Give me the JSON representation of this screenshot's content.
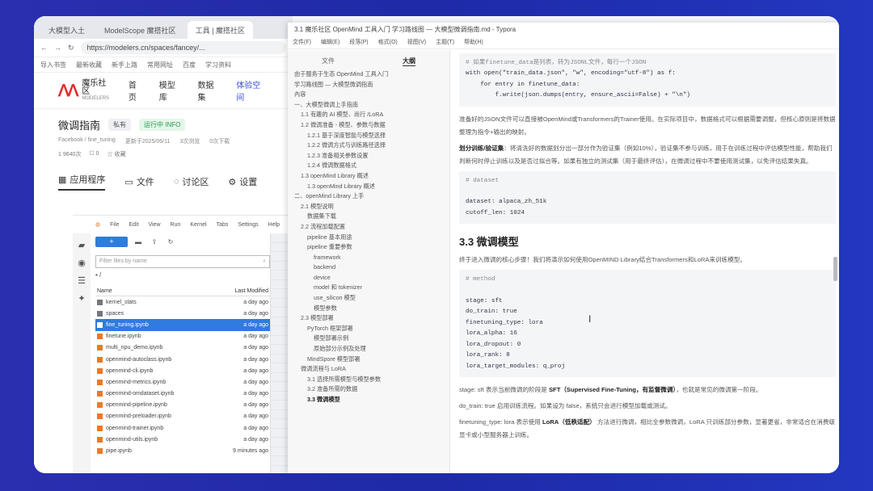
{
  "browser": {
    "tabs": [
      {
        "label": "大模型入土"
      },
      {
        "label": "ModelScope 魔搭社区"
      },
      {
        "label": "工具 | 魔搭社区"
      }
    ],
    "url": "https://modelers.cn/spaces/fancey/...",
    "bookmarks": [
      "导入书签",
      "最新收藏",
      "新手上路",
      "常用网址",
      "百度",
      "学习资料"
    ],
    "site": {
      "logo_text": "魔乐社区",
      "logo_sub": "MODELERS",
      "nav": [
        "首页",
        "模型库",
        "数据集",
        "体验空间"
      ],
      "active_nav": "体验空间"
    },
    "project": {
      "title": "微调指南",
      "badge": "私有",
      "status": "运行中 INFO",
      "meta": [
        "Facebook / fine_tuning",
        "更新于2025/06/11",
        "3次浏览",
        "0次下载"
      ],
      "meta2": [
        "1 9640次",
        "☐ 0",
        "☆ 收藏"
      ],
      "tabs": [
        "应用程序",
        "文件",
        "讨论区",
        "设置"
      ]
    },
    "jupyter": {
      "menu": [
        "File",
        "Edit",
        "View",
        "Run",
        "Kernel",
        "Tabs",
        "Settings",
        "Help"
      ],
      "filter_placeholder": "Filter files by name",
      "crumb": "▪ /",
      "col_name": "Name",
      "col_modified": "Last Modified",
      "files": [
        {
          "name": "kernel_stats",
          "mod": "a day ago",
          "type": "folder"
        },
        {
          "name": "spaces",
          "mod": "a day ago",
          "type": "folder"
        },
        {
          "name": "fine_tuning.ipynb",
          "mod": "a day ago",
          "type": "nb",
          "selected": true
        },
        {
          "name": "finetune.ipynb",
          "mod": "a day ago",
          "type": "nb"
        },
        {
          "name": "multi_npu_demo.ipynb",
          "mod": "a day ago",
          "type": "nb"
        },
        {
          "name": "openmind-autoclass.ipynb",
          "mod": "a day ago",
          "type": "nb"
        },
        {
          "name": "openmind-cli.ipynb",
          "mod": "a day ago",
          "type": "nb"
        },
        {
          "name": "openmind-metrics.ipynb",
          "mod": "a day ago",
          "type": "nb"
        },
        {
          "name": "openmind-omdataset.ipynb",
          "mod": "a day ago",
          "type": "nb"
        },
        {
          "name": "openmind-pipeline.ipynb",
          "mod": "a day ago",
          "type": "nb"
        },
        {
          "name": "openmind-preloader.ipynb",
          "mod": "a day ago",
          "type": "nb"
        },
        {
          "name": "openmind-trainer.ipynb",
          "mod": "a day ago",
          "type": "nb"
        },
        {
          "name": "openmind-utils.ipynb",
          "mod": "a day ago",
          "type": "nb"
        },
        {
          "name": "pipe.ipynb",
          "mod": "9 minutes ago",
          "type": "nb"
        }
      ]
    }
  },
  "typora": {
    "title": "3.1 魔乐社区 OpenMind 工具入门 学习路线图 — 大模型微调指南.md - Typora",
    "menu": [
      "文件(F)",
      "编辑(E)",
      "段落(P)",
      "格式(O)",
      "视图(V)",
      "主题(T)",
      "帮助(H)"
    ],
    "outline_tabs": [
      "文件",
      "大纲"
    ],
    "outline": [
      {
        "t": "由于服务于生态 OpenMind 工具入门",
        "lvl": 0
      },
      {
        "t": "学习路线图 — 大模型微调指南",
        "lvl": 0
      },
      {
        "t": "內容",
        "lvl": 0
      },
      {
        "t": "一、大模型微调上手指南",
        "lvl": 0
      },
      {
        "t": "1.1 有趣的 AI 模型、尚行 /LoRA",
        "lvl": 1
      },
      {
        "t": "1.2 微调准备 - 模型、参数与数据",
        "lvl": 1
      },
      {
        "t": "1.2.1 基于深度智能与模型选择",
        "lvl": 2
      },
      {
        "t": "1.2.2 微调方式与训练路径选择",
        "lvl": 2
      },
      {
        "t": "1.2.3 准备相关参数设置",
        "lvl": 2
      },
      {
        "t": "1.2.4 微调数据格式",
        "lvl": 2
      },
      {
        "t": "1.3 openMind Library 概述",
        "lvl": 1
      },
      {
        "t": "1.3 openMind Library 概述",
        "lvl": 2
      },
      {
        "t": "二、openMind Library 上手",
        "lvl": 0
      },
      {
        "t": "2.1 模型说明",
        "lvl": 1
      },
      {
        "t": "数据集下载",
        "lvl": 2
      },
      {
        "t": "2.2 流程加载配置",
        "lvl": 1
      },
      {
        "t": "pipeline 基本用途",
        "lvl": 2
      },
      {
        "t": "pipeline 重要参数",
        "lvl": 2
      },
      {
        "t": "framework",
        "lvl": 3
      },
      {
        "t": "backend",
        "lvl": 3
      },
      {
        "t": "device",
        "lvl": 3
      },
      {
        "t": "model 和 tokenizer",
        "lvl": 3
      },
      {
        "t": "use_silicon 模型",
        "lvl": 3
      },
      {
        "t": "模型参数",
        "lvl": 3
      },
      {
        "t": "2.3 模型部署",
        "lvl": 1
      },
      {
        "t": "PyTorch 框架部署",
        "lvl": 2
      },
      {
        "t": "模型部署示例",
        "lvl": 3
      },
      {
        "t": "原始部分示例及处理",
        "lvl": 3
      },
      {
        "t": "MindSpore 模型部署",
        "lvl": 2
      },
      {
        "t": "微调流程与 LoRA",
        "lvl": 1
      },
      {
        "t": "3.1 选择所需模型与模型参数",
        "lvl": 2
      },
      {
        "t": "3.2 准备所需的数据",
        "lvl": 2
      },
      {
        "t": "3.3 微调模型",
        "lvl": 2,
        "bold": true
      }
    ],
    "content": {
      "code1": [
        "# 如果finetune_data是列表，转为JSONL文件，每行一个JSON",
        "with open(\"train_data.json\", \"w\", encoding=\"utf-8\") as f:",
        "    for entry in finetune_data:",
        "        f.write(json.dumps(entry, ensure_ascii=False) + \"\\n\")"
      ],
      "para1": "准备好的JSON文件可以直接被OpenMind或Transformers的Trainer使用。在实际项目中，数据格式可以根据需要调整，但核心原则是将数据整理为指令+输出的映射。",
      "para2_bold": "划分训练/验证集",
      "para2": "：将清洗好的数据划分出一部分作为验证集（例如10%），验证集不参与训练，用于在训练过程中评估模型性能，帮助我们判断何时停止训练以及是否过拟合等。如果有独立的测试集（用于最终评估），在微调过程中不要使用测试集，以免评估结果失真。",
      "code2": [
        "# dataset",
        "",
        "dataset: alpaca_zh_51k",
        "cutoff_len: 1024"
      ],
      "h3": "3.3 微调模型",
      "para3": "终于进入微调的核心步骤！我们将演示如何使用OpenMIND Library结合Transformers和LoRA来训练模型。",
      "code3": [
        "# method",
        "",
        "stage: sft",
        "do_train: true",
        "finetuning_type: lora",
        "lora_alpha: 16",
        "lora_dropout: 0",
        "lora_rank: 8",
        "lora_target_modules: q_proj"
      ],
      "para4a": "stage: sft 表示当前微调的阶段是",
      "para4b": "SFT（Supervised Fine-Tuning，有监督微调）",
      "para4c": "，也就是常见的微调第一阶段。",
      "para5": "do_train: true 启用训练流程。如果设为 false，系统只会进行模型加载或测试。",
      "para6a": "finetuning_type: lora 表示使用",
      "para6b": "LoRA（低秩适配）",
      "para6c": "方法进行微调，相比全参数微调，LoRA 只训练部分参数，显著更省，非常适合在消费级显卡或小型服务器上训练。"
    }
  }
}
